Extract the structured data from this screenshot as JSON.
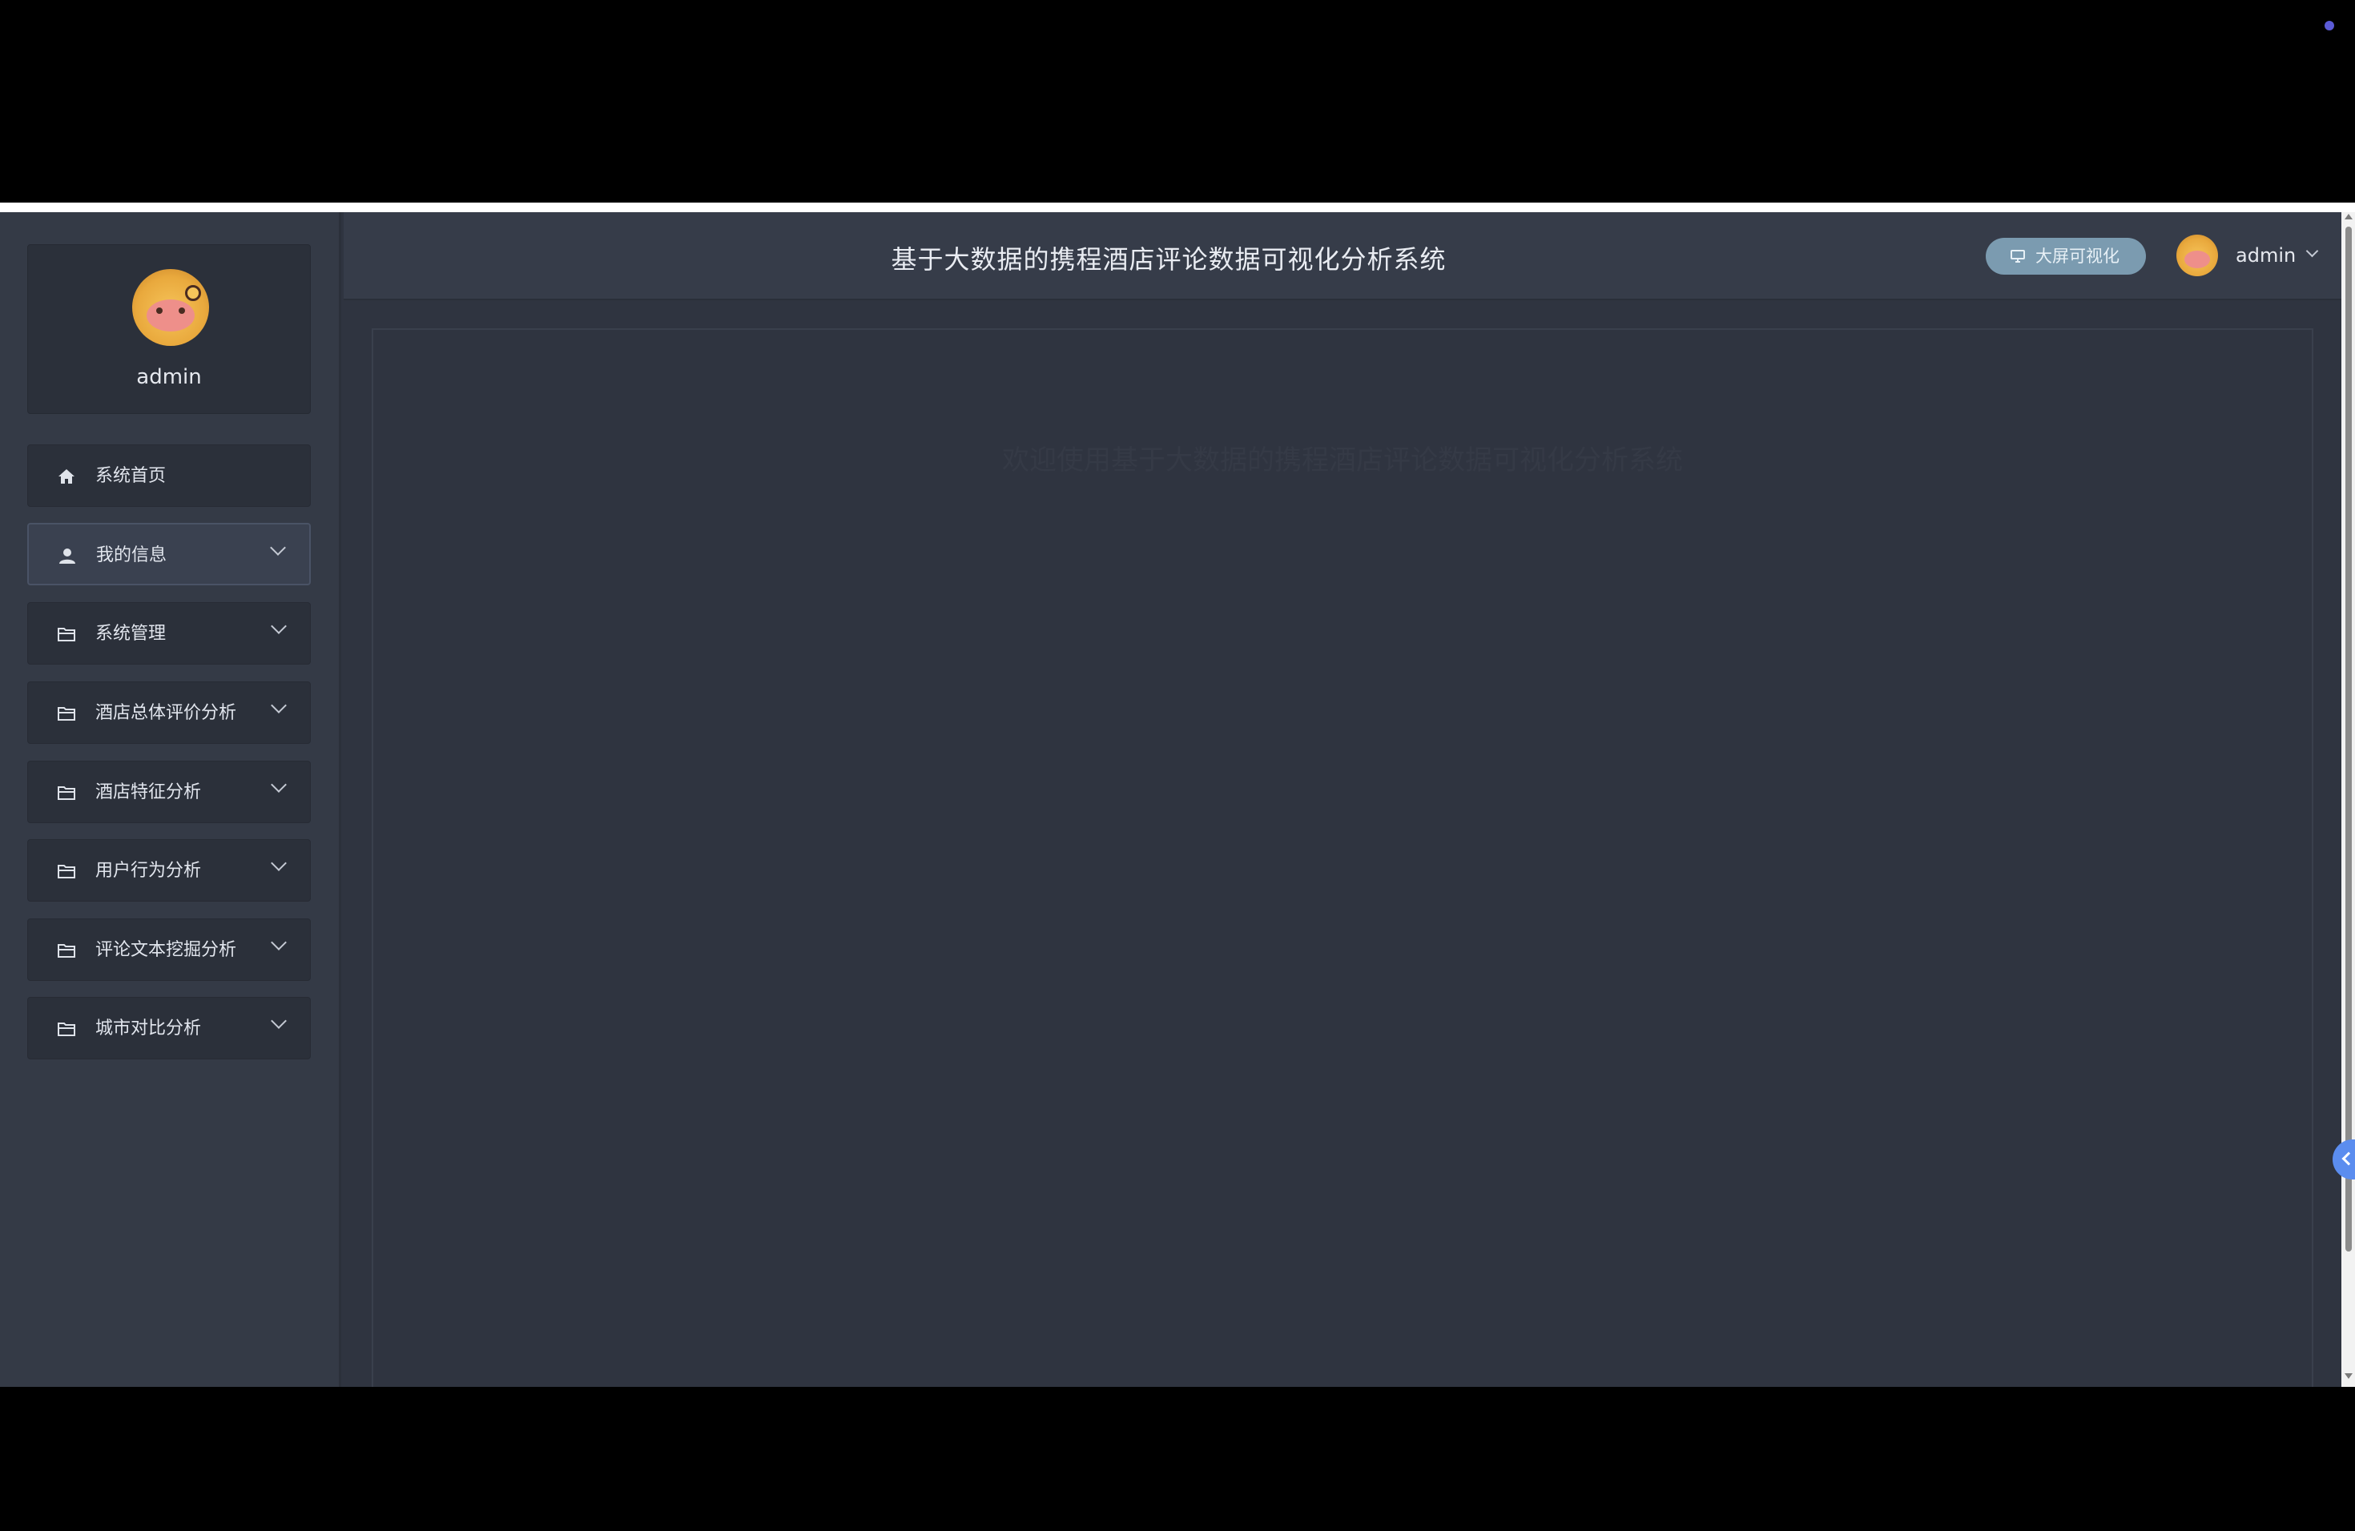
{
  "app": {
    "title": "基于大数据的携程酒店评论数据可视化分析系统",
    "username": "admin",
    "bigscreen_label": "大屏可视化"
  },
  "sidebar": {
    "profile_name": "admin",
    "items": [
      {
        "label": "系统首页",
        "icon": "home-icon",
        "has_children": false
      },
      {
        "label": "我的信息",
        "icon": "user-icon",
        "has_children": true,
        "active": true
      },
      {
        "label": "系统管理",
        "icon": "folder-icon",
        "has_children": true
      },
      {
        "label": "酒店总体评价分析",
        "icon": "folder-icon",
        "has_children": true
      },
      {
        "label": "酒店特征分析",
        "icon": "folder-icon",
        "has_children": true
      },
      {
        "label": "用户行为分析",
        "icon": "folder-icon",
        "has_children": true
      },
      {
        "label": "评论文本挖掘分析",
        "icon": "folder-icon",
        "has_children": true
      },
      {
        "label": "城市对比分析",
        "icon": "folder-icon",
        "has_children": true
      }
    ]
  },
  "main": {
    "faint_heading": "欢迎使用基于大数据的携程酒店评论数据可视化分析系统"
  },
  "colors": {
    "accent": "#5b8def",
    "corner_dot": "#5b5bd6",
    "button_bg": "#7b9bb0",
    "sidebar_bg": "#343a46",
    "content_bg": "#2f3440"
  }
}
